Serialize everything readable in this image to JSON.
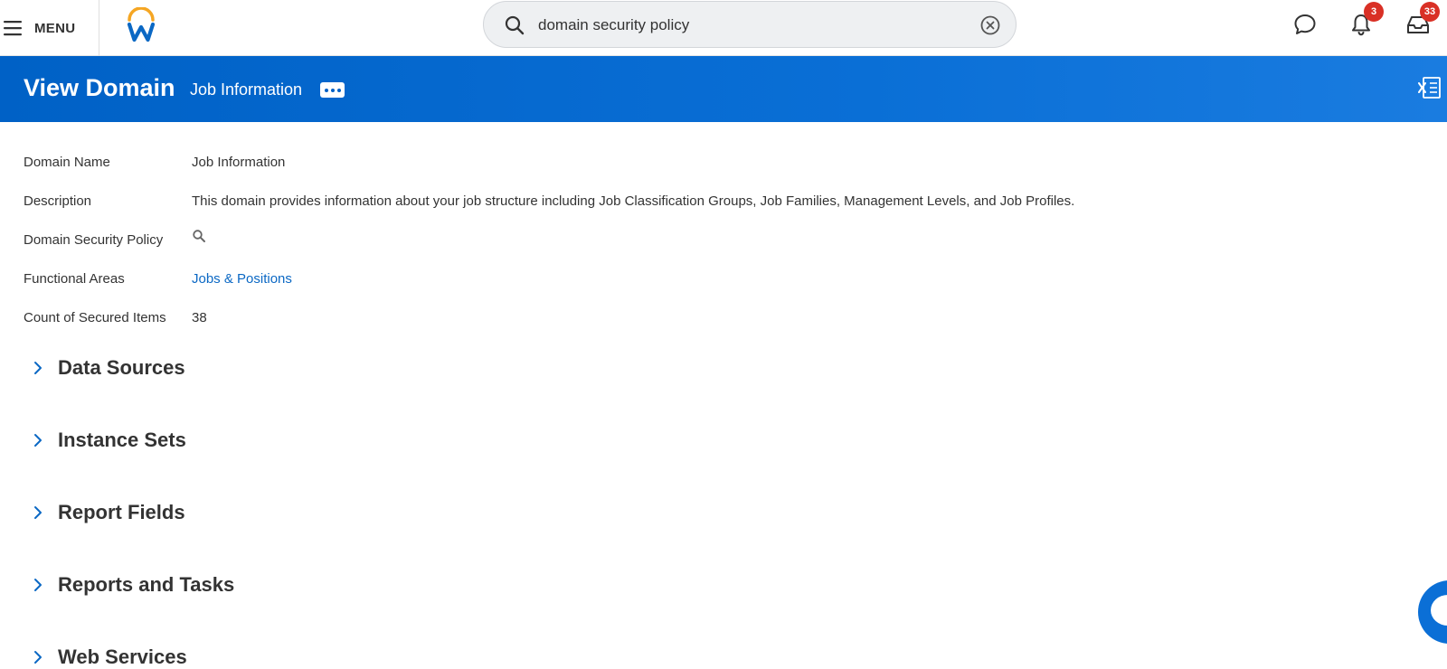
{
  "topbar": {
    "menu_label": "MENU",
    "search_value": "domain security policy",
    "notifications_count": "3",
    "inbox_count": "33"
  },
  "header": {
    "title": "View Domain",
    "subtitle": "Job Information"
  },
  "fields": {
    "domain_name": {
      "label": "Domain Name",
      "value": "Job Information"
    },
    "description": {
      "label": "Description",
      "value": "This domain provides information about your job structure including Job Classification Groups, Job Families, Management Levels, and Job Profiles."
    },
    "domain_security_policy": {
      "label": "Domain Security Policy"
    },
    "functional_areas": {
      "label": "Functional Areas",
      "value": "Jobs & Positions"
    },
    "count_secured_items": {
      "label": "Count of Secured Items",
      "value": "38"
    }
  },
  "sections": [
    {
      "title": "Data Sources"
    },
    {
      "title": "Instance Sets"
    },
    {
      "title": "Report Fields"
    },
    {
      "title": "Reports and Tasks"
    },
    {
      "title": "Web Services"
    }
  ],
  "colors": {
    "header_blue": "#0061c6",
    "link_blue": "#0b68c4",
    "badge_red": "#d93025",
    "logo_orange": "#f5a623"
  },
  "icons": [
    "hamburger-icon",
    "workday-logo",
    "search-icon",
    "clear-icon",
    "chat-icon",
    "bell-icon",
    "inbox-icon",
    "more-icon",
    "excel-export-icon",
    "chevron-right-icon",
    "assistant-icon"
  ]
}
